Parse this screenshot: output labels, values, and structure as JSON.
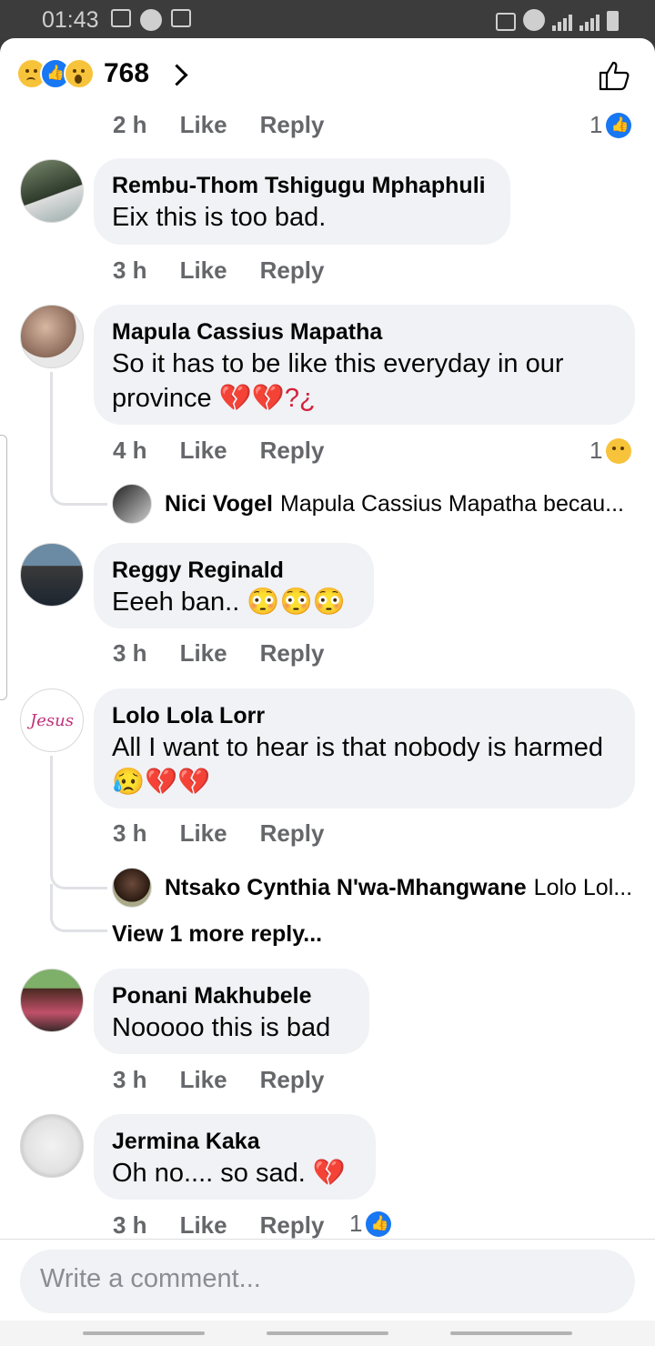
{
  "status": {
    "time": "01:43"
  },
  "header": {
    "reaction_count": "768"
  },
  "top_row": {
    "time": "2 h",
    "like": "Like",
    "reply": "Reply",
    "react_count": "1"
  },
  "comments": [
    {
      "author": "Rembu-Thom Tshigugu Mphaphuli",
      "text": "Eix this is too bad.",
      "time": "3 h",
      "like": "Like",
      "reply": "Reply"
    },
    {
      "author": "Mapula Cassius Mapatha",
      "text": "So it has to be like this everyday in our province",
      "text_suffix": "💔💔?¿",
      "time": "4 h",
      "like": "Like",
      "reply": "Reply",
      "react_count": "1",
      "reply_preview": {
        "author": "Nici Vogel",
        "text": "Mapula Cassius Mapatha becau..."
      }
    },
    {
      "author": "Reggy Reginald",
      "text": "Eeeh ban..",
      "text_suffix": "😳😳😳",
      "time": "3 h",
      "like": "Like",
      "reply": "Reply"
    },
    {
      "author": "Lolo Lola Lorr",
      "text": "All I want to hear is that nobody is harmed",
      "text_suffix": "😥💔💔",
      "time": "3 h",
      "like": "Like",
      "reply": "Reply",
      "reply_preview": {
        "author": "Ntsako Cynthia N'wa-Mhangwane",
        "text": "Lolo Lol..."
      },
      "view_more": "View 1 more reply..."
    },
    {
      "author": "Ponani Makhubele",
      "text": "Nooooo this is bad",
      "time": "3 h",
      "like": "Like",
      "reply": "Reply"
    },
    {
      "author": "Jermina Kaka",
      "text": "Oh no.... so sad.",
      "text_suffix": "💔",
      "time": "3 h",
      "like": "Like",
      "reply": "Reply",
      "react_count": "1"
    }
  ],
  "composer": {
    "placeholder": "Write a comment..."
  },
  "avatar_labels": {
    "lolo": "Jesus"
  }
}
